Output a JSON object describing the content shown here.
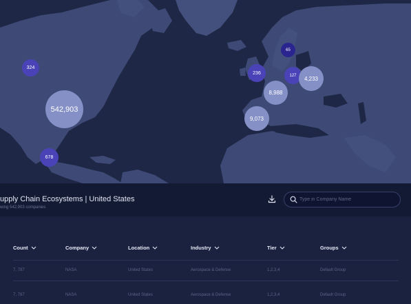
{
  "map": {
    "clusters": [
      {
        "label": "324",
        "tone": "dark"
      },
      {
        "label": "542,903",
        "tone": "light"
      },
      {
        "label": "678",
        "tone": "dark"
      },
      {
        "label": "236",
        "tone": "dark"
      },
      {
        "label": "65",
        "tone": "darkest"
      },
      {
        "label": "127",
        "tone": "dark"
      },
      {
        "label": "4,233",
        "tone": "light"
      },
      {
        "label": "8,988",
        "tone": "light"
      },
      {
        "label": "9,073",
        "tone": "light"
      }
    ]
  },
  "panel": {
    "title": "upply Chain Ecosystems | United States",
    "subtitle": "wing 542,903 companies"
  },
  "search": {
    "placeholder": "Type in Company Name",
    "value": ""
  },
  "table": {
    "columns": [
      "Count",
      "Company",
      "Location",
      "Industry",
      "Tier",
      "Groups"
    ],
    "rows": [
      [
        "7, 787",
        "NASA",
        "United States",
        "Aerospace & Defense",
        "1,2,3,4",
        "Default Group"
      ],
      [
        "7, 787",
        "NASA",
        "United States",
        "Aerospace & Defense",
        "1,2,3,4",
        "Default Group"
      ]
    ]
  },
  "icons": {
    "download": "download-icon",
    "search": "search-icon",
    "sort": "chevron-down-icon"
  },
  "colors": {
    "ocean": "#1e2746",
    "land": "#3e4a75",
    "cluster_dark": "#4a43b8",
    "cluster_darkest": "#2a248f",
    "cluster_light": "#8590c7",
    "panel": "#131a33",
    "table_bg": "#1a2240"
  }
}
